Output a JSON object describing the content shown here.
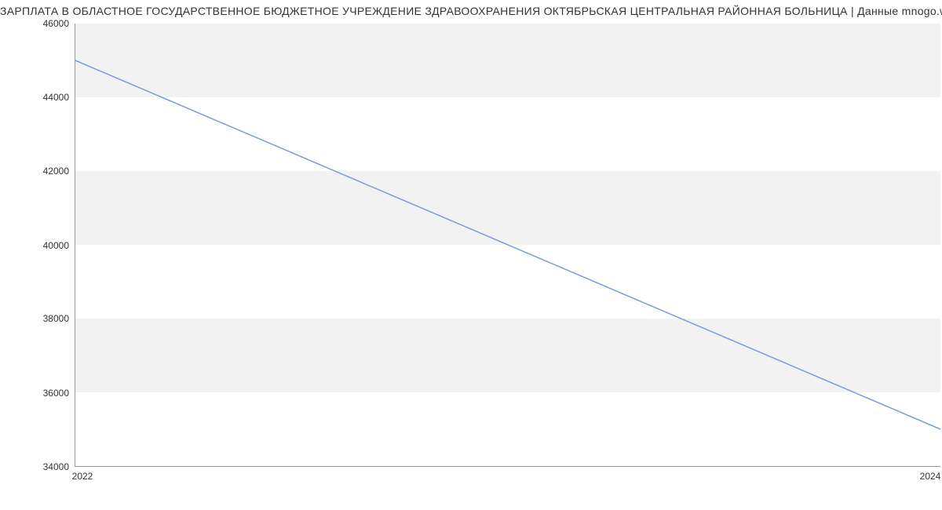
{
  "chart_data": {
    "type": "line",
    "title": "ЗАРПЛАТА В ОБЛАСТНОЕ ГОСУДАРСТВЕННОЕ БЮДЖЕТНОЕ УЧРЕЖДЕНИЕ ЗДРАВООХРАНЕНИЯ ОКТЯБРЬСКАЯ ЦЕНТРАЛЬНАЯ РАЙОННАЯ БОЛЬНИЦА | Данные mnogo.work",
    "x": [
      2022,
      2024
    ],
    "values": [
      45000,
      35000
    ],
    "ylim": [
      34000,
      46000
    ],
    "xlim": [
      2022,
      2024
    ],
    "y_ticks": [
      34000,
      36000,
      38000,
      40000,
      42000,
      44000,
      46000
    ],
    "x_ticks": [
      2022,
      2024
    ],
    "line_color": "#7a9bdb",
    "band_color": "#f2f2f2"
  }
}
